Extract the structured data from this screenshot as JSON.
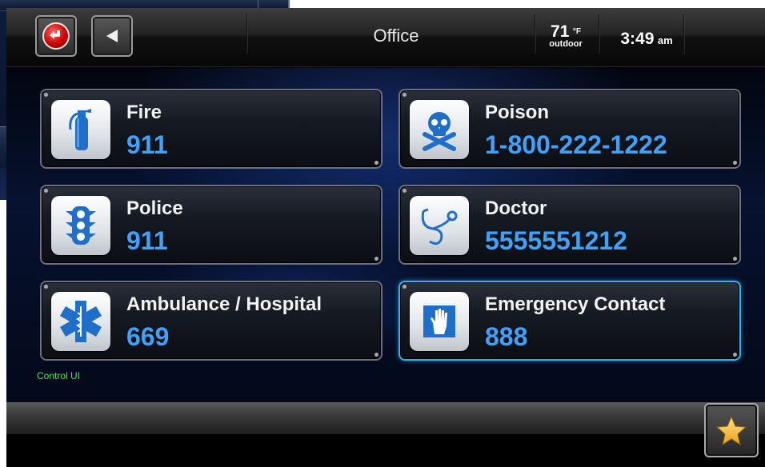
{
  "header": {
    "title": "Office",
    "temperature": "71",
    "temperature_unit": "°F",
    "temperature_label": "outdoor",
    "time": "3:49",
    "ampm": "am"
  },
  "contacts": [
    {
      "label": "Fire",
      "number": "911",
      "icon": "fire-extinguisher-icon"
    },
    {
      "label": "Poison",
      "number": "1-800-222-1222",
      "icon": "skull-crossbones-icon"
    },
    {
      "label": "Police",
      "number": "911",
      "icon": "traffic-light-icon"
    },
    {
      "label": "Doctor",
      "number": "5555551212",
      "icon": "stethoscope-icon"
    },
    {
      "label": "Ambulance / Hospital",
      "number": "669",
      "icon": "star-of-life-icon"
    },
    {
      "label": "Emergency Contact",
      "number": "888",
      "icon": "hand-icon"
    }
  ],
  "footer": {
    "control_label": "Control UI",
    "favorite_icon": "star-icon"
  },
  "colors": {
    "number": "#3fa2ff",
    "selected_border": "#36b0e8",
    "control_label": "#5ae04a"
  }
}
